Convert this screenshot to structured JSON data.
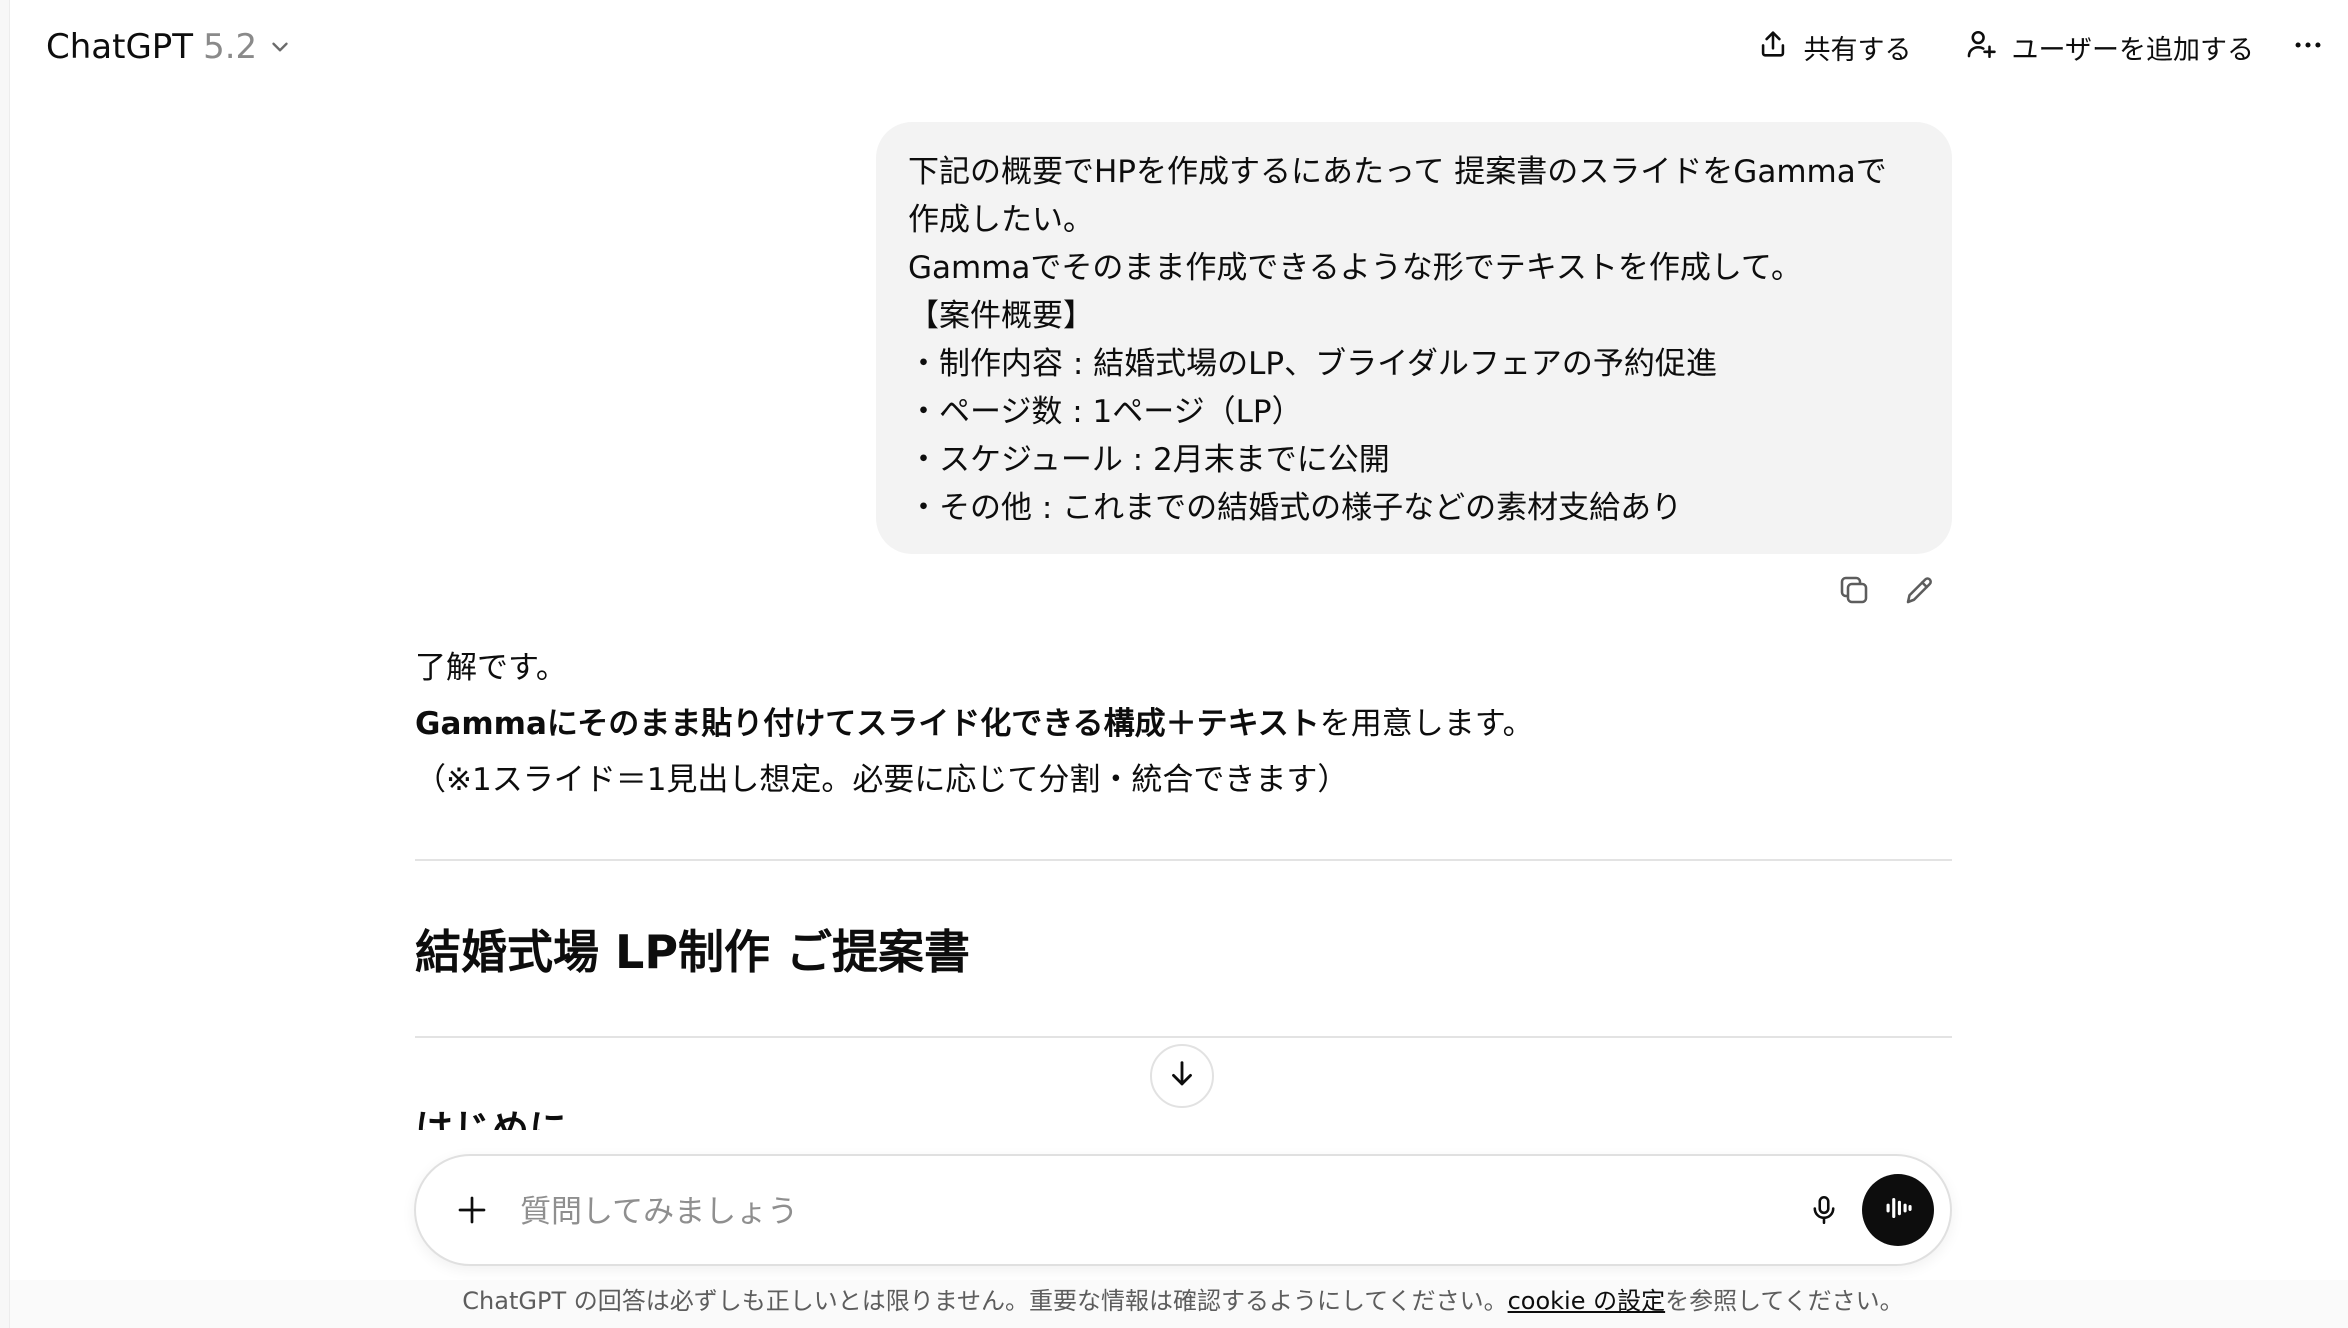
{
  "header": {
    "model_name": "ChatGPT",
    "model_version": "5.2",
    "share_label": "共有する",
    "add_user_label": "ユーザーを追加する"
  },
  "user_message": {
    "lines": [
      "下記の概要でHPを作成するにあたって 提案書のスライドをGammaで",
      "作成したい。",
      "Gammaでそのまま作成できるような形でテキストを作成して。",
      "【案件概要】",
      "・制作内容 : 結婚式場のLP、ブライダルフェアの予約促進",
      "・ページ数 : 1ページ（LP）",
      "・スケジュール : 2月末までに公開",
      "・その他 : これまでの結婚式の様子などの素材支給あり"
    ]
  },
  "assistant_message": {
    "line1": "了解です。",
    "line2_bold": "Gammaにそのまま貼り付けてスライド化できる構成＋テキスト",
    "line2_rest": "を用意します。",
    "line3": "（※1スライド＝1見出し想定。必要に応じて分割・統合できます）",
    "heading1": "結婚式場 LP制作 ご提案書",
    "heading2": "はじめに"
  },
  "composer": {
    "placeholder": "質問してみましょう"
  },
  "footer": {
    "disclaimer_before": "ChatGPT の回答は必ずしも正しいとは限りません。重要な情報は確認するようにしてください。",
    "cookie_link": "cookie の設定",
    "disclaimer_after": "を参照してください。"
  },
  "icons": {
    "share": "upload-icon",
    "add_user": "person-plus-icon",
    "more": "ellipsis-icon",
    "copy": "copy-icon",
    "edit": "pencil-icon",
    "scroll": "arrow-down-icon",
    "plus": "plus-icon",
    "mic": "microphone-icon",
    "voice": "voice-waveform-icon"
  }
}
